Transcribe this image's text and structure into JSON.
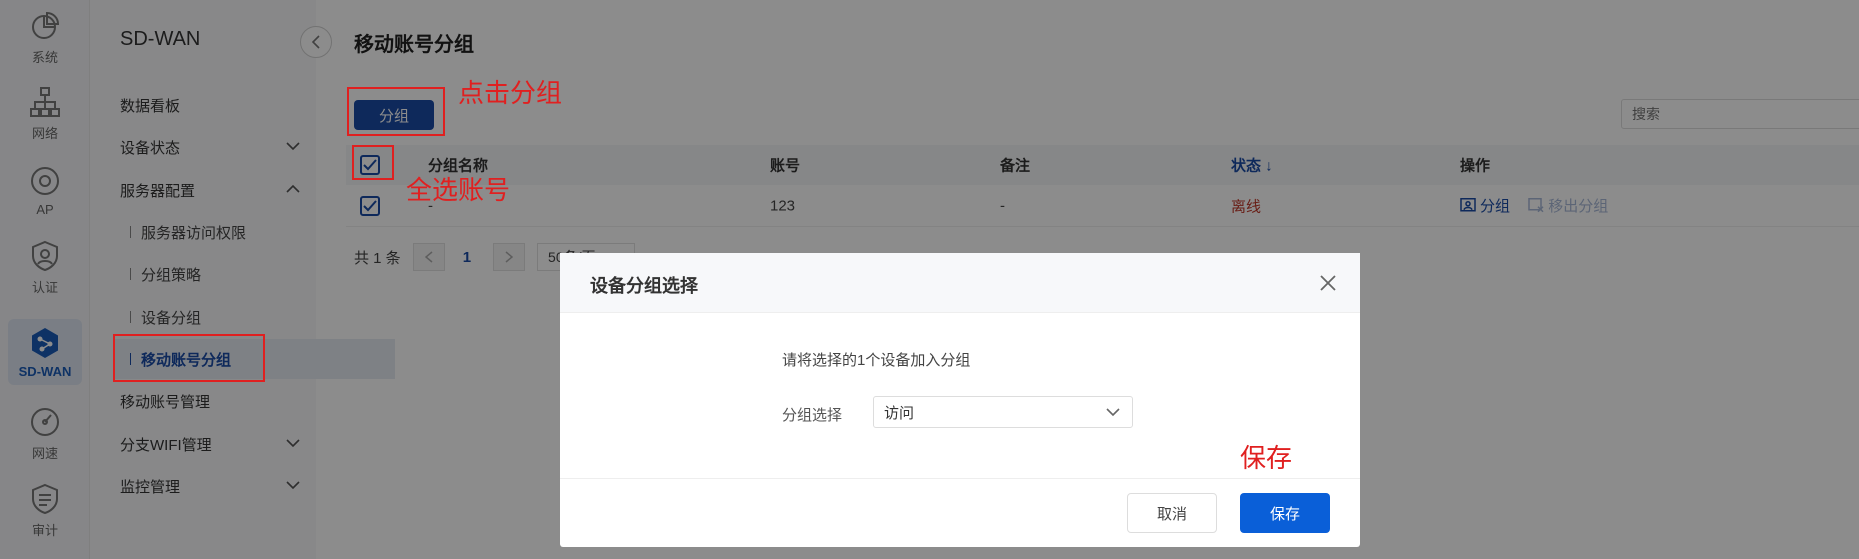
{
  "rail": [
    {
      "label": "系统",
      "icon": "pie-chart-icon"
    },
    {
      "label": "网络",
      "icon": "network-icon"
    },
    {
      "label": "AP",
      "icon": "ap-icon"
    },
    {
      "label": "认证",
      "icon": "shield-user-icon"
    },
    {
      "label": "SD-WAN",
      "icon": "sdwan-icon"
    },
    {
      "label": "网速",
      "icon": "speedometer-icon"
    },
    {
      "label": "审计",
      "icon": "audit-icon"
    }
  ],
  "submenu": {
    "title": "SD-WAN",
    "items": {
      "dashboard": "数据看板",
      "device_status": "设备状态",
      "server_config": "服务器配置",
      "server_access": "服务器访问权限",
      "group_policy": "分组策略",
      "device_group": "设备分组",
      "mobile_account_group": "移动账号分组",
      "mobile_account_mgmt": "移动账号管理",
      "branch_wifi": "分支WIFI管理",
      "monitor": "监控管理"
    }
  },
  "main": {
    "title": "移动账号分组",
    "group_button": "分组",
    "search_placeholder": "搜索",
    "table": {
      "headers": {
        "name": "分组名称",
        "account": "账号",
        "remark": "备注",
        "status": "状态 ↓",
        "ops": "操作"
      },
      "rows": [
        {
          "name": "-",
          "account": "123",
          "remark": "-",
          "status": "离线",
          "op_group": "分组",
          "op_remove": "移出分组"
        }
      ]
    },
    "pager": {
      "total": "共 1 条",
      "page": "1",
      "page_size": "50条/页"
    }
  },
  "annotations": {
    "click_group": "点击分组",
    "select_all": "全选账号",
    "save": "保存"
  },
  "modal": {
    "title": "设备分组选择",
    "message": "请将选择的1个设备加入分组",
    "label": "分组选择",
    "selected": "访问",
    "cancel": "取消",
    "save": "保存"
  },
  "colors": {
    "primary": "#1a4ba6",
    "save_button": "#0a5fd8",
    "annotation": "#e02020",
    "offline": "#c0392b"
  }
}
